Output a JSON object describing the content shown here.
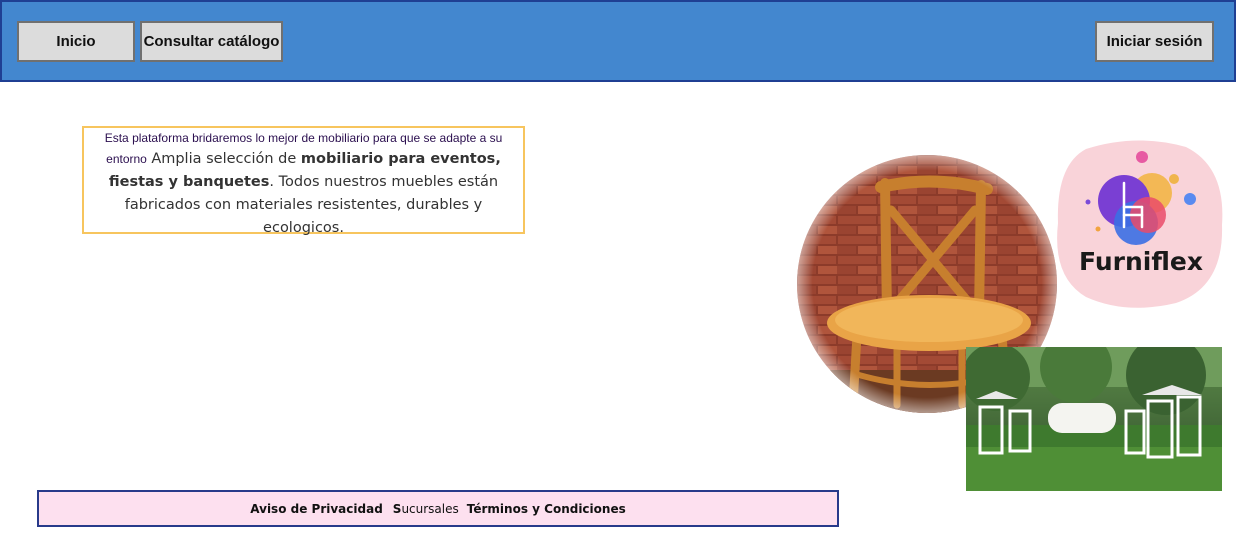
{
  "nav": {
    "home_label": "Inicio",
    "catalog_label": "Consultar catálogo",
    "login_label": "Iniciar sesión"
  },
  "intro": {
    "lead": "Esta plataforma bridaremos lo mejor de mobiliario para que se adapte a su entorno",
    "text_1": "Amplia selección de ",
    "bold_1": "mobiliario para eventos, fiestas y banquetes",
    "text_2": ". Todos nuestros muebles están fabricados con materiales resistentes, durables y ecologicos."
  },
  "brand": {
    "logo_text": "Furniflex"
  },
  "footer": {
    "privacy_label": "Aviso de Privacidad",
    "branches_first": "S",
    "branches_rest": "ucursales",
    "terms_label": "Términos y Condiciones"
  },
  "colors": {
    "topbar": "#4387cf",
    "topbar_border": "#1f3f93",
    "button_bg": "#dcdcdc",
    "intro_border": "#f7c55e",
    "footer_bg": "#fde0ef",
    "footer_border": "#283a8a"
  }
}
